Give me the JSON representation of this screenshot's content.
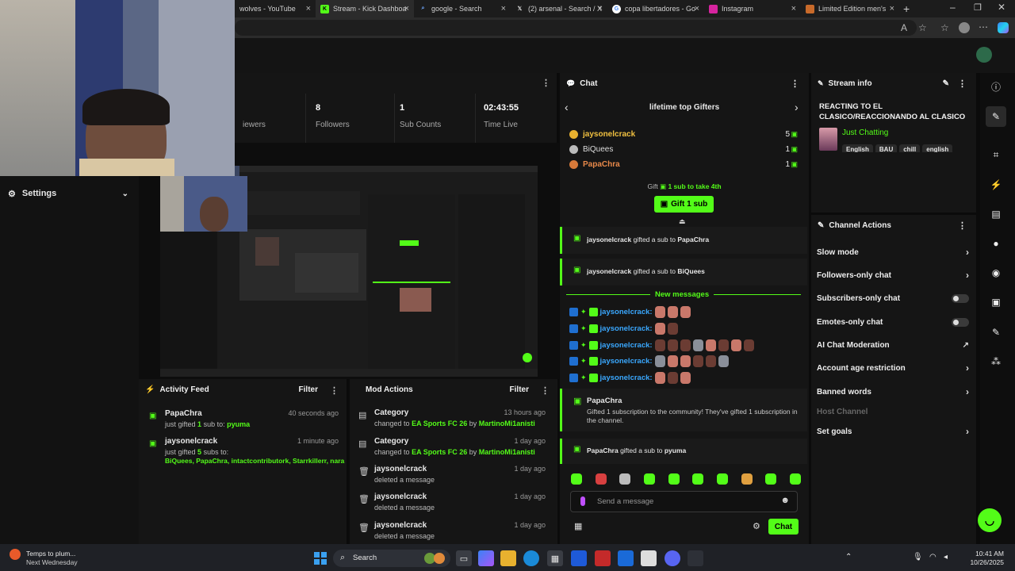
{
  "browser": {
    "tabs": [
      {
        "title": "wolves - YouTube",
        "icon": "youtube-icon"
      },
      {
        "title": "Stream - Kick Dashboa",
        "icon": "kick-icon"
      },
      {
        "title": "google - Search",
        "icon": "search-icon"
      },
      {
        "title": "(2) arsenal - Search / X",
        "icon": "x-icon"
      },
      {
        "title": "copa libertadores - Go",
        "icon": "google-icon"
      },
      {
        "title": "Instagram",
        "icon": "instagram-icon"
      },
      {
        "title": "Limited Edition men's",
        "icon": "shop-icon"
      }
    ],
    "new_tab": "+",
    "close_tab": "×"
  },
  "stats": [
    {
      "number": "",
      "label": "iewers"
    },
    {
      "number": "8",
      "label": "Followers"
    },
    {
      "number": "1",
      "label": "Sub Counts"
    },
    {
      "number": "02:43:55",
      "label": "Time Live"
    }
  ],
  "settings": {
    "title": "Settings"
  },
  "chat": {
    "title": "Chat",
    "leaderboard_title": "lifetime top Gifters",
    "gifters": [
      {
        "name": "jaysonelcrack",
        "count": "5"
      },
      {
        "name": "BiQuees",
        "count": "1"
      },
      {
        "name": "PapaChra",
        "count": "1"
      }
    ],
    "gift_prompt_pre": "Gift",
    "gift_prompt_post": "1 sub to take 4th",
    "gift_button": "Gift 1 sub",
    "gift_events": [
      {
        "user": "jaysonelcrack",
        "text": "gifted a sub to",
        "target": "PapaChra"
      },
      {
        "user": "jaysonelcrack",
        "text": "gifted a sub to",
        "target": "BiQuees"
      }
    ],
    "new_messages": "New messages",
    "emote_user": "jaysonelcrack:",
    "community_gift": {
      "user": "PapaChra",
      "text": "Gifted 1 subscription to the community! They've gifted 1 subscription in the channel."
    },
    "last_gift": {
      "user": "PapaChra",
      "text": "gifted a sub to",
      "target": "pyuma"
    },
    "input_placeholder": "Send a message",
    "send_button": "Chat"
  },
  "stream_info": {
    "title": "Stream info",
    "stream_title": "REACTING TO EL CLASICO/REACCIONANDO AL CLASICO",
    "category": "Just Chatting",
    "tags": [
      "English",
      "BAU",
      "chill",
      "english"
    ]
  },
  "channel_actions": {
    "title": "Channel Actions",
    "items": [
      {
        "label": "Slow mode",
        "control": "chevron"
      },
      {
        "label": "Followers-only chat",
        "control": "chevron"
      },
      {
        "label": "Subscribers-only chat",
        "control": "toggle"
      },
      {
        "label": "Emotes-only chat",
        "control": "toggle"
      },
      {
        "label": "AI Chat Moderation",
        "control": "external"
      },
      {
        "label": "Account age restriction",
        "control": "chevron"
      },
      {
        "label": "Banned words",
        "control": "chevron"
      },
      {
        "label": "Host Channel",
        "control": "none"
      },
      {
        "label": "Set goals",
        "control": "chevron"
      }
    ]
  },
  "activity_feed": {
    "title": "Activity Feed",
    "filter": "Filter",
    "items": [
      {
        "user": "PapaChra",
        "time": "40 seconds ago",
        "line": "just gifted",
        "amount": "1",
        "suffix": "sub to:",
        "targets": "pyuma"
      },
      {
        "user": "jaysonelcrack",
        "time": "1 minute ago",
        "line": "just gifted",
        "amount": "5",
        "suffix": "subs to:",
        "targets": "BiQuees, PapaChra, intactcontributork, Starrkillerr, nara"
      }
    ]
  },
  "mod_actions": {
    "title": "Mod Actions",
    "filter": "Filter",
    "items": [
      {
        "title": "Category",
        "time": "13 hours ago",
        "pre": "changed to",
        "value": "EA Sports FC 26",
        "by": "by",
        "actor": "MartinoMi1anisti"
      },
      {
        "title": "Category",
        "time": "1 day ago",
        "pre": "changed to",
        "value": "EA Sports FC 26",
        "by": "by",
        "actor": "MartinoMi1anisti"
      },
      {
        "title": "jaysonelcrack",
        "time": "1 day ago",
        "pre": "deleted a message"
      },
      {
        "title": "jaysonelcrack",
        "time": "1 day ago",
        "pre": "deleted a message"
      },
      {
        "title": "jaysonelcrack",
        "time": "1 day ago",
        "pre": "deleted a message"
      }
    ]
  },
  "taskbar": {
    "weather_line1": "Temps to plum...",
    "weather_line2": "Next Wednesday",
    "search": "Search",
    "time": "10:41 AM",
    "date": "10/26/2025"
  },
  "colors": {
    "accent": "#53fc18",
    "panel": "#151515",
    "background": "#0b0b0b"
  }
}
